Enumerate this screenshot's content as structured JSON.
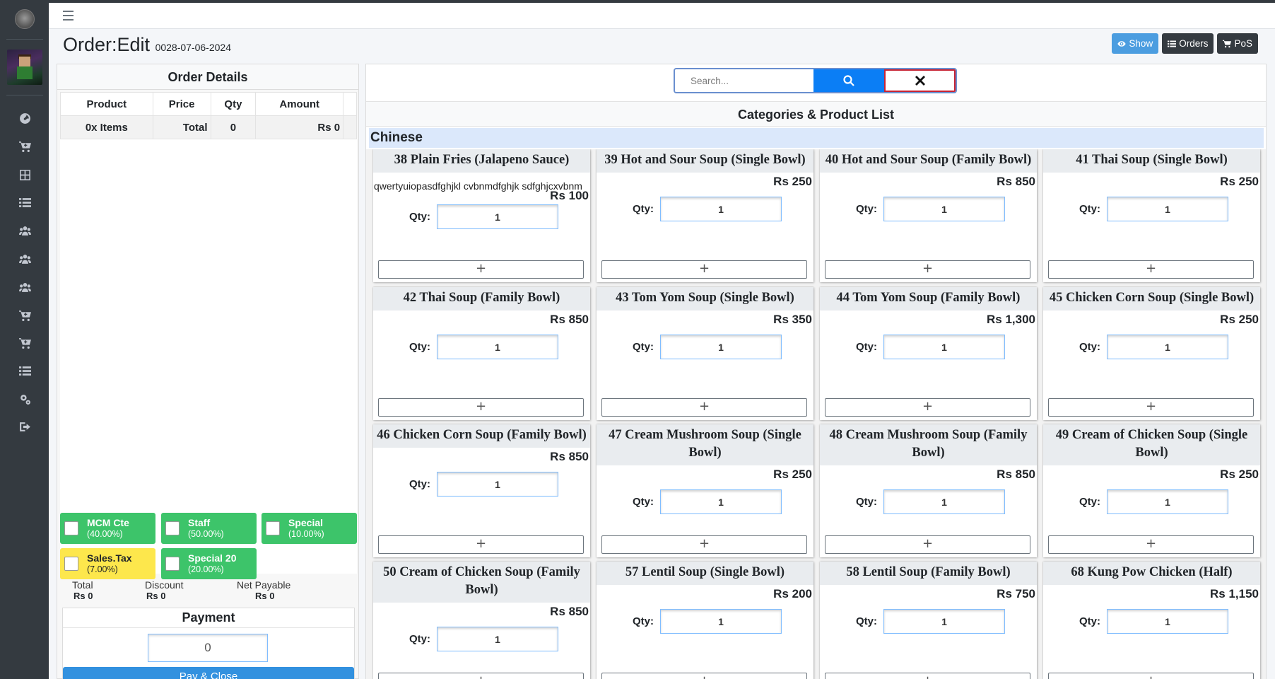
{
  "sidebar": {
    "icons": [
      "dashboard-icon",
      "cart-icon",
      "grid-icon",
      "list-icon",
      "users-icon",
      "users-icon",
      "users-icon",
      "cart-icon",
      "cart-icon",
      "list-icon",
      "gears-icon",
      "sign-out-icon"
    ]
  },
  "header": {
    "title": "Order:Edit",
    "order_no": "0028-07-06-2024",
    "buttons": {
      "show": "Show",
      "orders": "Orders",
      "pos": "PoS"
    }
  },
  "order_details": {
    "title": "Order Details",
    "columns": [
      "Product",
      "Price",
      "Qty",
      "Amount"
    ],
    "totals": {
      "items": "0x Items",
      "label": "Total",
      "qty": "0",
      "amount": "Rs 0"
    },
    "discounts": [
      {
        "name": "MCM Cte",
        "percent": "(40.00%)",
        "color": "#3dc46a"
      },
      {
        "name": "Staff",
        "percent": "(50.00%)",
        "color": "#3dc46a"
      },
      {
        "name": "Special",
        "percent": "(10.00%)",
        "color": "#3dc46a"
      },
      {
        "name": "Sales.Tax",
        "percent": "(7.00%)",
        "color": "#fde74c"
      },
      {
        "name": "Special 20",
        "percent": "(20.00%)",
        "color": "#3dc46a"
      }
    ],
    "summary": {
      "total_label": "Total",
      "total_value": "Rs 0",
      "discount_label": "Discount",
      "discount_value": "Rs 0",
      "net_label": "Net Payable",
      "net_value": "Rs 0"
    },
    "payment": {
      "title": "Payment",
      "value": "0",
      "button": "Pay & Close"
    }
  },
  "products": {
    "search_placeholder": "Search...",
    "title": "Categories & Product List",
    "category": "Chinese",
    "qty_label": "Qty:",
    "add_label": "+",
    "items": [
      {
        "name": "38 Plain Fries (Jalapeno Sauce)",
        "desc": "qwertyuiopasdfghjkl cvbnmdfghjk sdfghjcxvbnm",
        "price": "Rs 100",
        "qty": "1"
      },
      {
        "name": "39 Hot and Sour Soup (Single Bowl)",
        "price": "Rs 250",
        "qty": "1"
      },
      {
        "name": "40 Hot and Sour Soup (Family Bowl)",
        "price": "Rs 850",
        "qty": "1"
      },
      {
        "name": "41 Thai Soup (Single Bowl)",
        "price": "Rs 250",
        "qty": "1"
      },
      {
        "name": "42 Thai Soup (Family Bowl)",
        "price": "Rs 850",
        "qty": "1"
      },
      {
        "name": "43 Tom Yom Soup (Single Bowl)",
        "price": "Rs 350",
        "qty": "1"
      },
      {
        "name": "44 Tom Yom Soup (Family Bowl)",
        "price": "Rs 1,300",
        "qty": "1"
      },
      {
        "name": "45 Chicken Corn Soup (Single Bowl)",
        "price": "Rs 250",
        "qty": "1"
      },
      {
        "name": "46 Chicken Corn Soup (Family Bowl)",
        "price": "Rs 850",
        "qty": "1"
      },
      {
        "name": "47 Cream Mushroom Soup (Single Bowl)",
        "price": "Rs 250",
        "qty": "1"
      },
      {
        "name": "48 Cream Mushroom Soup (Family Bowl)",
        "price": "Rs 850",
        "qty": "1"
      },
      {
        "name": "49 Cream of Chicken Soup (Single Bowl)",
        "price": "Rs 250",
        "qty": "1"
      },
      {
        "name": "50 Cream of Chicken Soup (Family Bowl)",
        "price": "Rs 850",
        "qty": "1"
      },
      {
        "name": "57 Lentil Soup (Single Bowl)",
        "price": "Rs 200",
        "qty": "1"
      },
      {
        "name": "58 Lentil Soup (Family Bowl)",
        "price": "Rs 750",
        "qty": "1"
      },
      {
        "name": "68 Kung Pow Chicken (Half)",
        "price": "Rs 1,150",
        "qty": "1"
      }
    ]
  }
}
